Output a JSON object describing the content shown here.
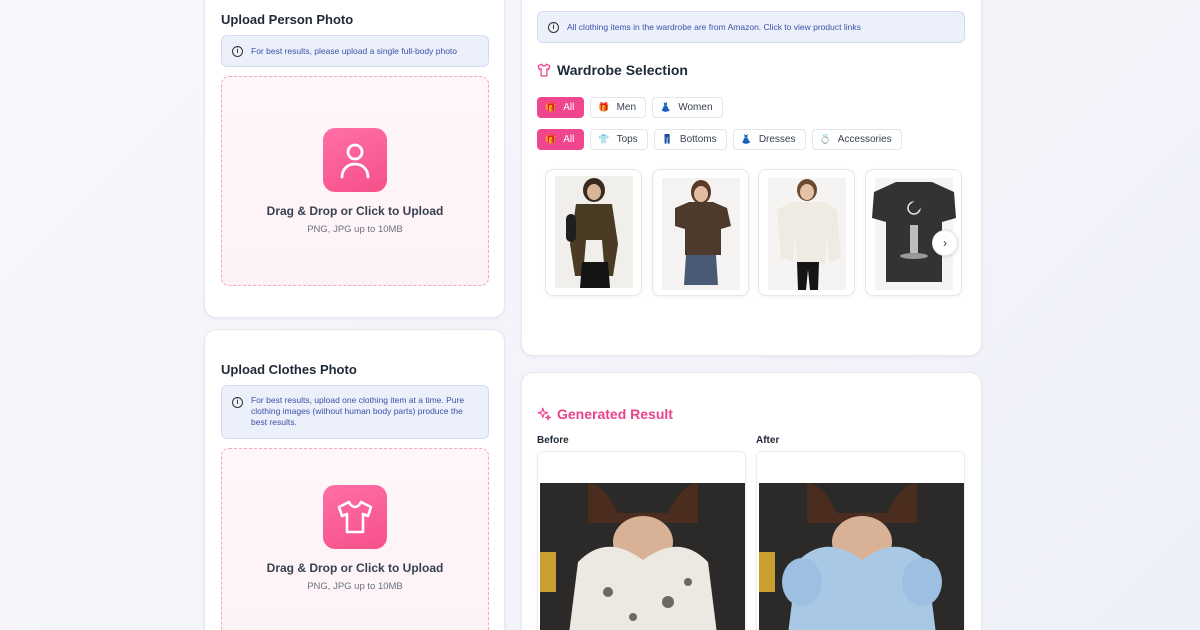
{
  "person_upload": {
    "title": "Upload Person Photo",
    "info": "For best results, please upload a single full-body photo",
    "drop_title": "Drag & Drop or Click to Upload",
    "drop_sub": "PNG, JPG up to 10MB"
  },
  "clothes_upload": {
    "title": "Upload Clothes Photo",
    "info": "For best results, upload one clothing item at a time. Pure clothing images (without human body parts) produce the best results.",
    "drop_title": "Drag & Drop or Click to Upload",
    "drop_sub": "PNG, JPG up to 10MB"
  },
  "wardrobe": {
    "notice": "All clothing items in the wardrobe are from Amazon. Click to view product links",
    "title": "Wardrobe Selection",
    "gender_filters": [
      {
        "label": "All",
        "icon": "gift-icon",
        "active": true
      },
      {
        "label": "Men",
        "icon": "gift-icon",
        "active": false
      },
      {
        "label": "Women",
        "icon": "dress-icon",
        "active": false
      }
    ],
    "category_filters": [
      {
        "label": "All",
        "icon": "gift-icon",
        "active": true
      },
      {
        "label": "Tops",
        "icon": "shirt-icon",
        "active": false
      },
      {
        "label": "Bottoms",
        "icon": "jeans-icon",
        "active": false
      },
      {
        "label": "Dresses",
        "icon": "dress-icon",
        "active": false
      },
      {
        "label": "Accessories",
        "icon": "ring-icon",
        "active": false
      }
    ],
    "products": [
      {
        "name": "olive-long-sleeve-top"
      },
      {
        "name": "brown-crop-tee"
      },
      {
        "name": "white-oversized-sweater"
      },
      {
        "name": "black-moon-graphic-tee"
      }
    ]
  },
  "result": {
    "title": "Generated Result",
    "before_label": "Before",
    "after_label": "After"
  },
  "colors": {
    "accent": "#f0458f",
    "info_bg": "#ecf0fb",
    "info_text": "#3d50a8"
  }
}
